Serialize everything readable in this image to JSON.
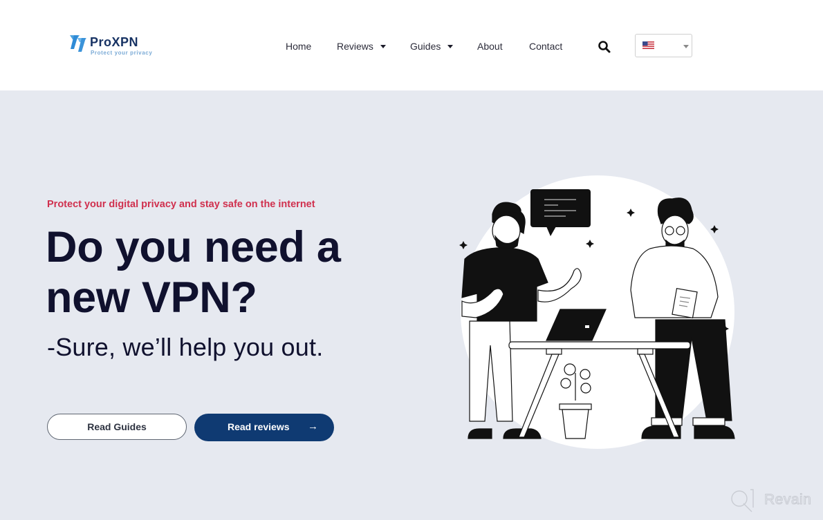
{
  "header": {
    "logo": {
      "name": "ProXPN",
      "tagline": "Protect your privacy",
      "icon": "proxpn-logo-icon"
    },
    "nav": [
      {
        "label": "Home",
        "has_dropdown": false
      },
      {
        "label": "Reviews",
        "has_dropdown": true
      },
      {
        "label": "Guides",
        "has_dropdown": true
      },
      {
        "label": "About",
        "has_dropdown": false
      },
      {
        "label": "Contact",
        "has_dropdown": false
      }
    ],
    "search_icon": "search-icon",
    "language_select": {
      "selected": "English (US)",
      "flag_icon": "us-flag-icon"
    }
  },
  "hero": {
    "eyebrow": "Protect your digital privacy and stay safe on the internet",
    "headline": "Do you need a new VPN?",
    "subline": "-Sure, we’ll help you out.",
    "buttons": {
      "guides_label": "Read Guides",
      "reviews_label": "Read reviews",
      "reviews_arrow": "→"
    },
    "illustration": "two-people-talking-illustration"
  },
  "watermark": {
    "text": "Revain"
  },
  "colors": {
    "page_bg": "#e6e9f0",
    "header_bg": "#ffffff",
    "accent_red": "#d0304e",
    "headline": "#10112e",
    "primary_button": "#0f3a72",
    "logo_navy": "#173263",
    "logo_light_blue": "#7aaad6"
  }
}
